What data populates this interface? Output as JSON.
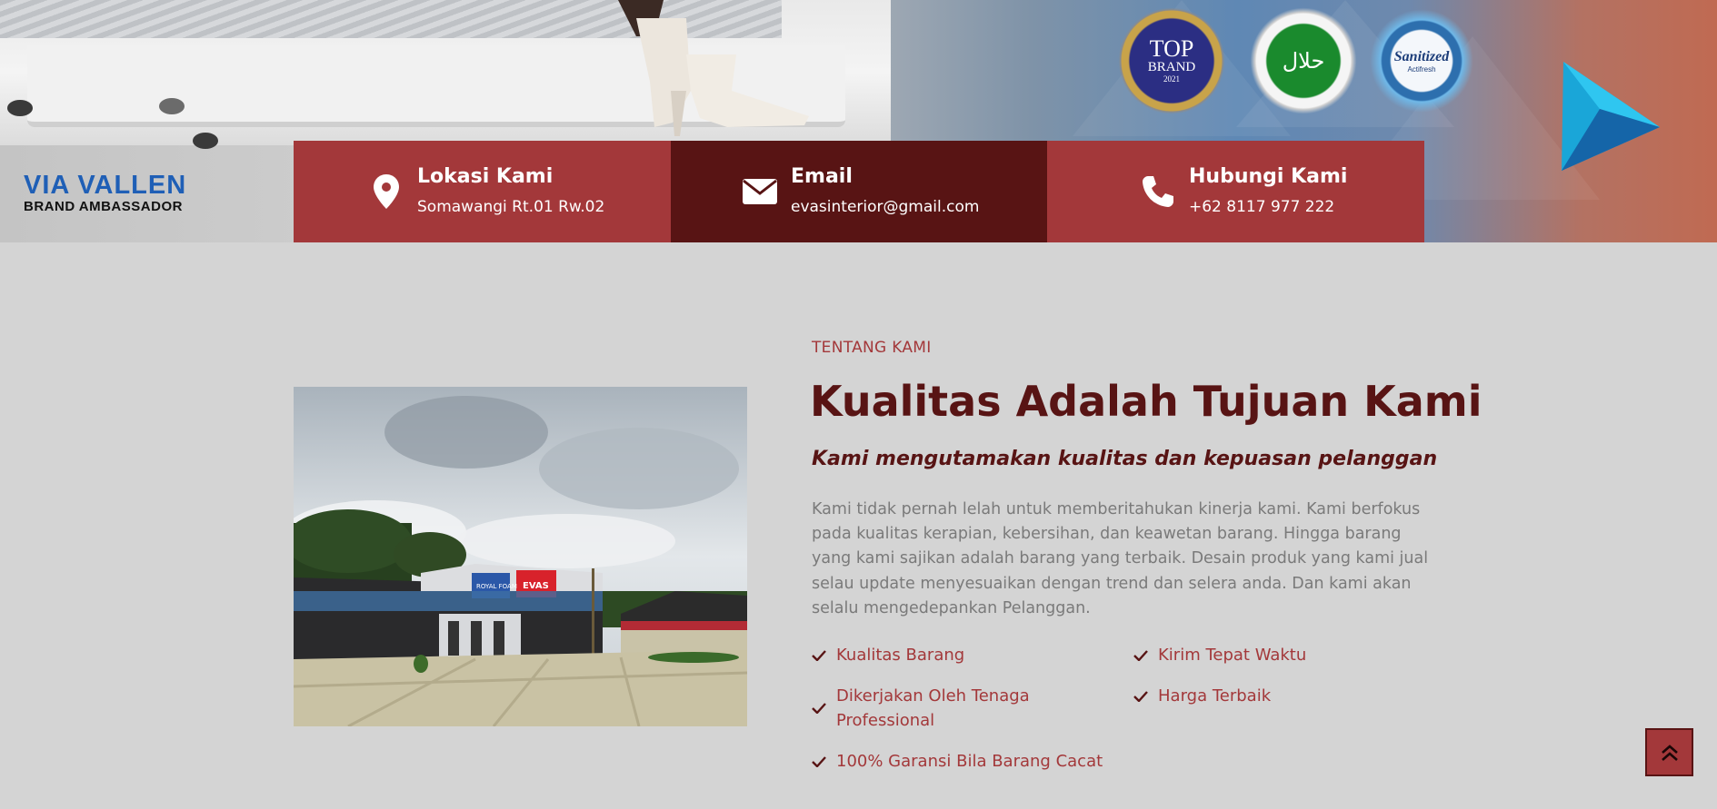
{
  "hero": {
    "ambassador_name": "VIA VALLEN",
    "ambassador_role": "BRAND AMBASSADOR",
    "badges": {
      "top_brand_line1": "TOP",
      "top_brand_line2": "BRAND",
      "top_brand_year": "2021",
      "halal_text": "حلال",
      "sanitized_text": "Sanitized",
      "sanitized_sub": "Actifresh"
    }
  },
  "contact": [
    {
      "icon": "map-pin-icon",
      "title": "Lokasi Kami",
      "value": "Somawangi Rt.01 Rw.02"
    },
    {
      "icon": "envelope-icon",
      "title": "Email",
      "value": "evasinterior@gmail.com"
    },
    {
      "icon": "phone-icon",
      "title": "Hubungi Kami",
      "value": "+62 8117 977 222"
    }
  ],
  "about": {
    "eyebrow": "TENTANG KAMI",
    "headline": "Kualitas Adalah Tujuan Kami",
    "subheadline": "Kami mengutamakan kualitas dan kepuasan pelanggan",
    "body": "Kami tidak pernah lelah untuk memberitahukan kinerja kami. Kami berfokus pada kualitas kerapian, kebersihan, dan keawetan barang. Hingga barang yang kami sajikan adalah barang yang terbaik. Desain produk yang kami jual selau update menyesuaikan dengan trend dan selera anda. Dan kami akan selalu mengedepankan Pelanggan.",
    "features": [
      "Kualitas Barang",
      "Kirim Tepat Waktu",
      "Dikerjakan Oleh Tenaga Professional",
      "Harga Terbaik",
      "100% Garansi Bila Barang Cacat"
    ],
    "photo_sign_left": "ROYAL FOAM",
    "photo_sign_right": "EVAS"
  },
  "colors": {
    "primary_red": "#a3383a",
    "dark_maroon": "#581414",
    "page_bg": "#d4d4d4",
    "body_text": "#7a7a7a"
  },
  "scroll_top_icon": "double-chevron-up-icon"
}
